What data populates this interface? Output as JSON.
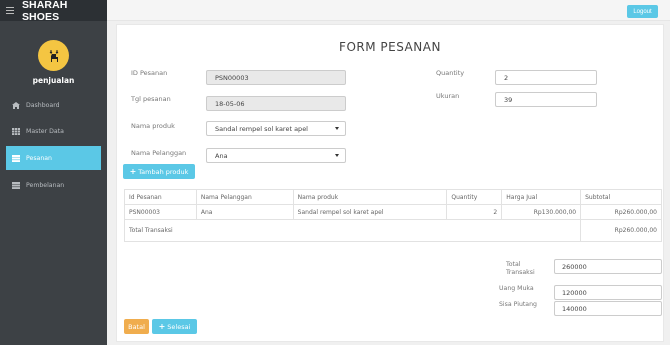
{
  "brand": "SHARAH SHOES",
  "user": {
    "name": "penjualan"
  },
  "nav": [
    {
      "label": "Dashboard"
    },
    {
      "label": "Master Data"
    },
    {
      "label": "Pesanan"
    },
    {
      "label": "Pembelanan"
    }
  ],
  "topbar": {
    "logout_label": "Logout"
  },
  "form": {
    "title": "FORM PESANAN",
    "id_label": "ID Pesanan",
    "id_value": "PSN00003",
    "tgl_label": "Tgl pesanan",
    "tgl_value": "18-05-06",
    "produk_label": "Nama produk",
    "produk_value": "Sandal rempel sol karet apel",
    "pelanggan_label": "Nama Pelanggan",
    "pelanggan_value": "Ana",
    "qty_label": "Quantity",
    "qty_value": "2",
    "ukuran_label": "Ukuran",
    "ukuran_value": "39",
    "tambah_label": "Tambah produk"
  },
  "table": {
    "headers": [
      "Id Pesanan",
      "Nama Pelanggan",
      "Nama produk",
      "Quantity",
      "Harga Jual",
      "Subtotal"
    ],
    "row": [
      "PSN00003",
      "Ana",
      "Sandal rempel sol karet apel",
      "2",
      "Rp130.000,00",
      "Rp260.000,00"
    ],
    "total_label": "Total Transaksi",
    "total_value": "Rp260.000,00"
  },
  "summary": {
    "total_label_1": "Total",
    "total_label_2": "Transaksi",
    "total_value": "260000",
    "uang_label": "Uang Muka",
    "uang_value": "120000",
    "sisa_label": "Sisa Piutang",
    "sisa_value": "140000"
  },
  "actions": {
    "batal_label": "Batal",
    "selesai_label": "Selesai"
  },
  "colors": {
    "sidebar": "#3d4145",
    "accent": "#5bc8e6",
    "warning": "#f0ad4e",
    "avatar": "#f4c542"
  }
}
